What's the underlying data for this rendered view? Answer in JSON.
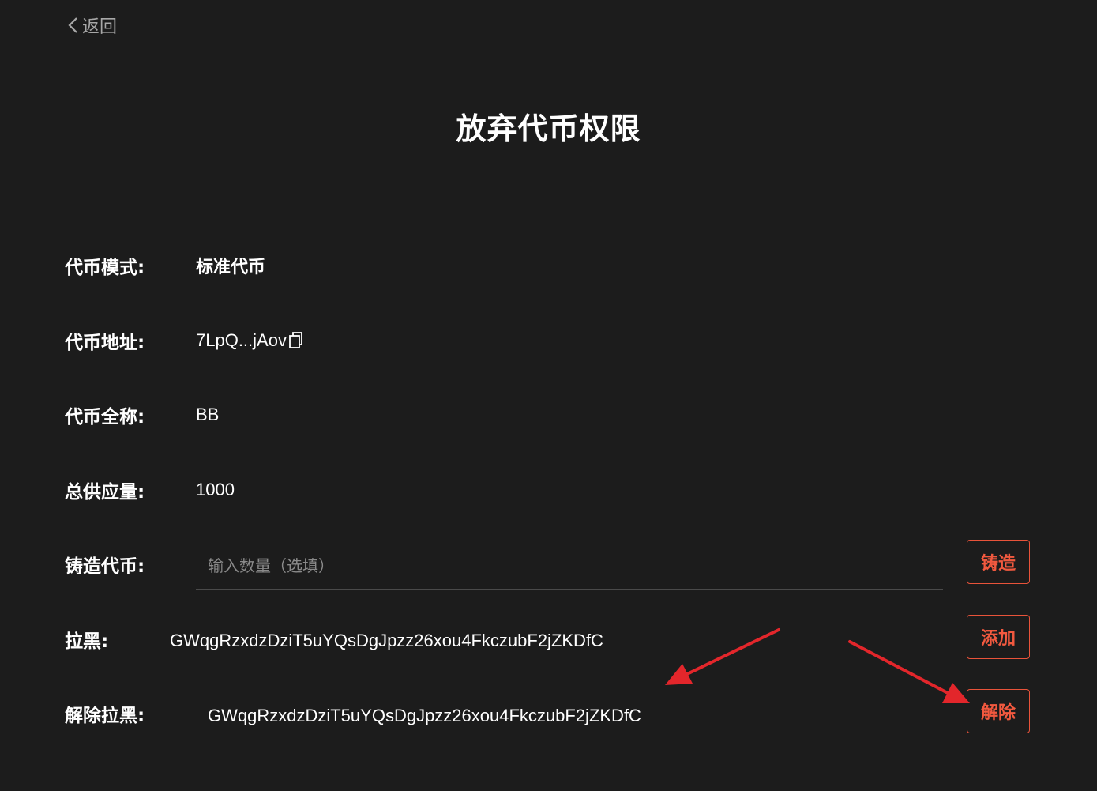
{
  "header": {
    "back_label": "返回",
    "title": "放弃代币权限"
  },
  "info": {
    "mode_label": "代币模式:",
    "mode_value": "标准代币",
    "address_label": "代币地址:",
    "address_value": "7LpQ...jAov",
    "name_label": "代币全称:",
    "name_value": "BB",
    "supply_label": "总供应量:",
    "supply_value": "1000"
  },
  "mint": {
    "label": "铸造代币:",
    "placeholder": "输入数量（选填）",
    "button": "铸造"
  },
  "blacklist": {
    "label": "拉黑:",
    "value": "GWqgRzxdzDziT5uYQsDgJpzz26xou4FkczubF2jZKDfC",
    "button": "添加"
  },
  "unblacklist": {
    "label": "解除拉黑:",
    "value": "GWqgRzxdzDziT5uYQsDgJpzz26xou4FkczubF2jZKDfC",
    "button": "解除"
  },
  "colors": {
    "background": "#1c1c1c",
    "accent": "#f2593f",
    "annotation_arrow": "#e3262b"
  },
  "icons": [
    "chevron-left-icon",
    "copy-icon"
  ]
}
